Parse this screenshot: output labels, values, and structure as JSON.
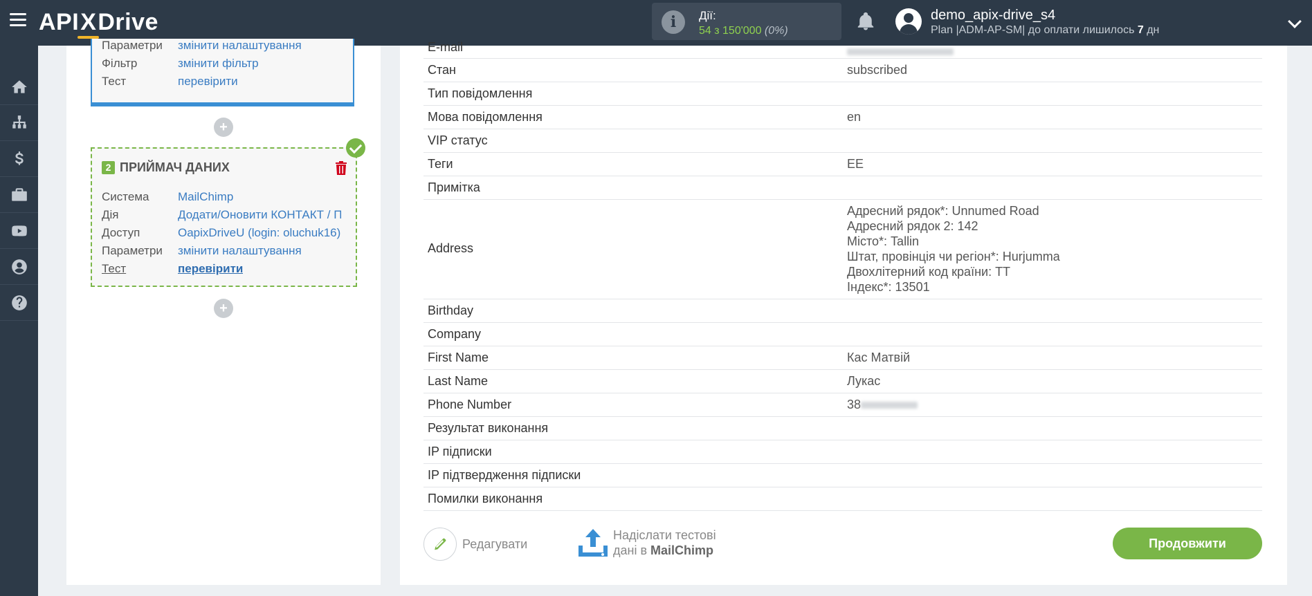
{
  "header": {
    "logo_left": "API",
    "logo_x": "X",
    "logo_right": "Drive",
    "actions_label": "Дії:",
    "actions_count": "54 з 150'000",
    "actions_percent": "(0%)",
    "user_name": "demo_apix-drive_s4",
    "plan_text": "Plan |ADM-AP-SM| до оплати лишилось ",
    "plan_days": "7",
    "plan_days_unit": " дн"
  },
  "sidebar": {
    "items": [
      "home-icon",
      "sitemap-icon",
      "dollar-icon",
      "briefcase-icon",
      "youtube-icon",
      "user-circle-icon",
      "help-icon"
    ]
  },
  "block1": {
    "rows": [
      {
        "k": "Параметри",
        "v": "змінити налаштування"
      },
      {
        "k": "Фільтр",
        "v": "змінити фільтр"
      },
      {
        "k": "Тест",
        "v": "перевірити"
      }
    ]
  },
  "block2": {
    "number": "2",
    "title": "ПРИЙМАЧ ДАНИХ",
    "rows": [
      {
        "k": "Система",
        "v": "MailChimp"
      },
      {
        "k": "Дія",
        "v": "Додати/Оновити КОНТАКТ / ПІДПИСНИКА"
      },
      {
        "k": "Доступ",
        "v": "OapixDriveU (login: oluchuk16)"
      },
      {
        "k": "Параметри",
        "v": "змінити налаштування"
      },
      {
        "k": "Тест",
        "v": "перевірити"
      }
    ]
  },
  "table": {
    "email_label": "E-mail",
    "rows": [
      {
        "k": "Стан",
        "v": "subscribed"
      },
      {
        "k": "Тип повідомлення",
        "v": ""
      },
      {
        "k": "Мова повідомлення",
        "v": "en"
      },
      {
        "k": "VIP статус",
        "v": ""
      },
      {
        "k": "Теги",
        "v": "ЕЕ"
      },
      {
        "k": "Примітка",
        "v": ""
      }
    ],
    "address_label": "Address",
    "address_lines": [
      "Адресний рядок*: Unnumed Road",
      "Адресний рядок 2: 142",
      "Місто*: Tallin",
      "Штат, провінція чи регіон*: Hurjumma",
      "Двохлітерний код країни: TT",
      "Індекс*: 13501"
    ],
    "rows2": [
      {
        "k": "Birthday",
        "v": ""
      },
      {
        "k": "Company",
        "v": ""
      },
      {
        "k": "First Name",
        "v": "Кас Матвій"
      },
      {
        "k": "Last Name",
        "v": "Лукас"
      }
    ],
    "phone_label": "Phone Number",
    "phone_prefix": "38",
    "rows3": [
      {
        "k": "Результат виконання",
        "v": ""
      },
      {
        "k": "IP підписки",
        "v": ""
      },
      {
        "k": "IP підтвердження підписки",
        "v": ""
      },
      {
        "k": "Помилки виконання",
        "v": ""
      }
    ]
  },
  "footer": {
    "edit_label": "Редагувати",
    "send_line1": "Надіслати тестові",
    "send_line2_prefix": "дані в ",
    "send_line2_system": "MailChimp",
    "continue_label": "Продовжити"
  }
}
